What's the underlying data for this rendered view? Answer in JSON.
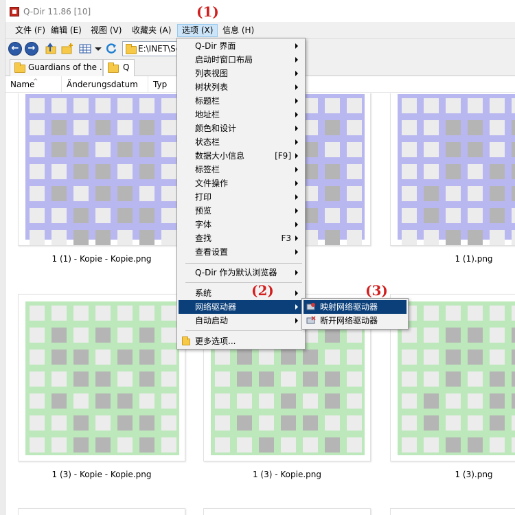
{
  "window": {
    "title": "Q-Dir 11.86 [10]"
  },
  "menubar": {
    "items": [
      {
        "label": "文件 (F)"
      },
      {
        "label": "编辑 (E)"
      },
      {
        "label": "视图 (V)"
      },
      {
        "label": "收藏夹 (A)"
      },
      {
        "label": "选项 (X)"
      },
      {
        "label": "信息 (H)"
      }
    ]
  },
  "toolbar": {
    "back_glyph": "←",
    "forward_glyph": "→",
    "address": "E:\\INET\\Sof"
  },
  "tabs": [
    {
      "label": "Guardians of the ..."
    },
    {
      "label": "Q"
    }
  ],
  "columns": [
    {
      "label": "Name"
    },
    {
      "label": "Änderungsdatum"
    },
    {
      "label": "Typ"
    }
  ],
  "sort_arrow": "^",
  "thumbnails": {
    "row1_color": "#b9b7ef",
    "row2_color": "#bde8bb",
    "cell_light": "#ececec",
    "cell_dark": "#b5b5b5",
    "row1": [
      {
        "caption": "1 (1) - Kopie - Kopie.png"
      },
      {
        "caption": ".png"
      },
      {
        "caption": "1 (1).png"
      }
    ],
    "row2": [
      {
        "caption": "1 (3) - Kopie - Kopie.png"
      },
      {
        "caption": "1 (3) - Kopie.png"
      },
      {
        "caption": "1 (3).png"
      }
    ]
  },
  "options_menu": {
    "items": [
      {
        "label": "Q-Dir 界面",
        "shortcut": ""
      },
      {
        "label": "启动时窗口布局",
        "shortcut": ""
      },
      {
        "label": "列表视图",
        "shortcut": ""
      },
      {
        "label": "树状列表",
        "shortcut": ""
      },
      {
        "label": "标题栏",
        "shortcut": ""
      },
      {
        "label": "地址栏",
        "shortcut": ""
      },
      {
        "label": "颜色和设计",
        "shortcut": ""
      },
      {
        "label": "状态栏",
        "shortcut": ""
      },
      {
        "label": "数据大小信息",
        "shortcut": "[F9]"
      },
      {
        "label": "标签栏",
        "shortcut": ""
      },
      {
        "label": "文件操作",
        "shortcut": ""
      },
      {
        "label": "打印",
        "shortcut": ""
      },
      {
        "label": "预览",
        "shortcut": ""
      },
      {
        "label": "字体",
        "shortcut": ""
      },
      {
        "label": "查找",
        "shortcut": "F3"
      },
      {
        "label": "查看设置",
        "shortcut": ""
      }
    ],
    "default_browser": "Q-Dir 作为默认浏览器",
    "system": "系统",
    "network_drives": "网络驱动器",
    "autostart": "自动启动",
    "more_options": "更多选项..."
  },
  "network_submenu": {
    "items": [
      {
        "label": "映射网络驱动器"
      },
      {
        "label": "断开网络驱动器"
      }
    ]
  },
  "annotations": {
    "step1": "(1)",
    "step2": "(2)",
    "step3": "(3)"
  },
  "colors": {
    "highlight": "#0a3f7a",
    "annotation": "#d11f1f",
    "menu_active_bg": "#cce4f7"
  }
}
